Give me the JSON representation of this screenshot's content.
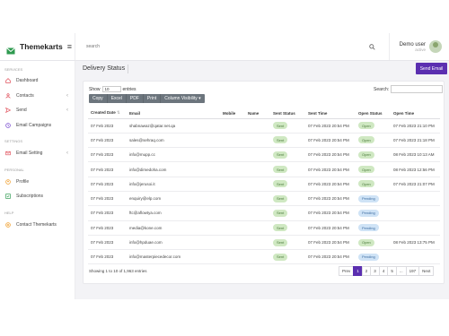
{
  "brand": {
    "title": "Themekarts"
  },
  "search": {
    "placeholder": "search"
  },
  "user": {
    "name": "Demo user",
    "status": "active"
  },
  "sidebar": {
    "sections": [
      "SERVICES",
      "SETTINGS",
      "PERSONAL",
      "HELP"
    ],
    "items": [
      {
        "label": "Dashboard",
        "icon": "home-icon",
        "color": "#e0505b"
      },
      {
        "label": "Contacts",
        "icon": "user-icon",
        "color": "#e0505b",
        "chevron": "‹"
      },
      {
        "label": "Send",
        "icon": "send-icon",
        "color": "#e0505b",
        "chevron": "‹"
      },
      {
        "label": "Email Campaigns",
        "icon": "clock-icon",
        "color": "#7b4fd1"
      },
      {
        "label": "Email Setting",
        "icon": "mail-icon",
        "color": "#e0505b",
        "chevron": "‹"
      },
      {
        "label": "Profile",
        "icon": "profile-icon",
        "color": "#f0a030"
      },
      {
        "label": "Subscriptions",
        "icon": "check-square-icon",
        "color": "#3aa05a"
      },
      {
        "label": "Contact Themekarts",
        "icon": "support-icon",
        "color": "#f0a030"
      }
    ]
  },
  "page": {
    "title": "Delivery Status",
    "send_button": "Send Email"
  },
  "table_controls": {
    "show": "Show",
    "entries_value": "10",
    "entries": "entries",
    "search_label": "Search:"
  },
  "export_buttons": [
    "Copy",
    "Excel",
    "PDF",
    "Print",
    "Column Visibility ▾"
  ],
  "columns": [
    "Created Date",
    "Email",
    "Mobile",
    "Name",
    "Sent Status",
    "Sent Time",
    "Open Status",
    "Open Time"
  ],
  "rows": [
    {
      "date": "07 Feb 2023",
      "email": "shabnawaz@qatar.net.qa",
      "mobile": "",
      "name": "",
      "sent": "Sent",
      "sent_time": "07 Feb 2023 20:54 PM",
      "open": "Open",
      "open_time": "07 Feb 2023 21:10 PM"
    },
    {
      "date": "07 Feb 2023",
      "email": "sales@sehraq.com",
      "mobile": "",
      "name": "",
      "sent": "Sent",
      "sent_time": "07 Feb 2023 20:54 PM",
      "open": "Open",
      "open_time": "07 Feb 2023 21:18 PM"
    },
    {
      "date": "07 Feb 2023",
      "email": "info@mupp.cc",
      "mobile": "",
      "name": "",
      "sent": "Sent",
      "sent_time": "07 Feb 2023 20:54 PM",
      "open": "Open",
      "open_time": "08 Feb 2023 10:13 AM"
    },
    {
      "date": "07 Feb 2023",
      "email": "info@dimedoha.com",
      "mobile": "",
      "name": "",
      "sent": "Sent",
      "sent_time": "07 Feb 2023 20:54 PM",
      "open": "Open",
      "open_time": "08 Feb 2023 12:56 PM"
    },
    {
      "date": "07 Feb 2023",
      "email": "info@jerusoi.it",
      "mobile": "",
      "name": "",
      "sent": "Sent",
      "sent_time": "07 Feb 2023 20:54 PM",
      "open": "Open",
      "open_time": "07 Feb 2023 21:07 PM"
    },
    {
      "date": "07 Feb 2023",
      "email": "enquiry@elp.com",
      "mobile": "",
      "name": "",
      "sent": "Sent",
      "sent_time": "07 Feb 2023 20:54 PM",
      "open": "Pending",
      "open_time": ""
    },
    {
      "date": "07 Feb 2023",
      "email": "ftc@aflowtya.com",
      "mobile": "",
      "name": "",
      "sent": "Sent",
      "sent_time": "07 Feb 2023 20:54 PM",
      "open": "Pending",
      "open_time": ""
    },
    {
      "date": "07 Feb 2023",
      "email": "media@kone.com",
      "mobile": "",
      "name": "",
      "sent": "Sent",
      "sent_time": "07 Feb 2023 20:54 PM",
      "open": "Pending",
      "open_time": ""
    },
    {
      "date": "07 Feb 2023",
      "email": "info@hpduae.com",
      "mobile": "",
      "name": "",
      "sent": "Sent",
      "sent_time": "07 Feb 2023 20:54 PM",
      "open": "Open",
      "open_time": "08 Feb 2023 13:75 PM"
    },
    {
      "date": "07 Feb 2023",
      "email": "info@masterpiecedecor.com",
      "mobile": "",
      "name": "",
      "sent": "Sent",
      "sent_time": "07 Feb 2023 20:54 PM",
      "open": "Pending",
      "open_time": ""
    }
  ],
  "footer": {
    "info": "Showing 1 to 10 of 1,963 entries"
  },
  "pagination": [
    "Prev",
    "1",
    "2",
    "3",
    "4",
    "5",
    "...",
    "197",
    "Next"
  ],
  "colors": {
    "accent": "#5b2fb0",
    "sent": "#cfe8c2",
    "pending": "#cfe3f6"
  }
}
